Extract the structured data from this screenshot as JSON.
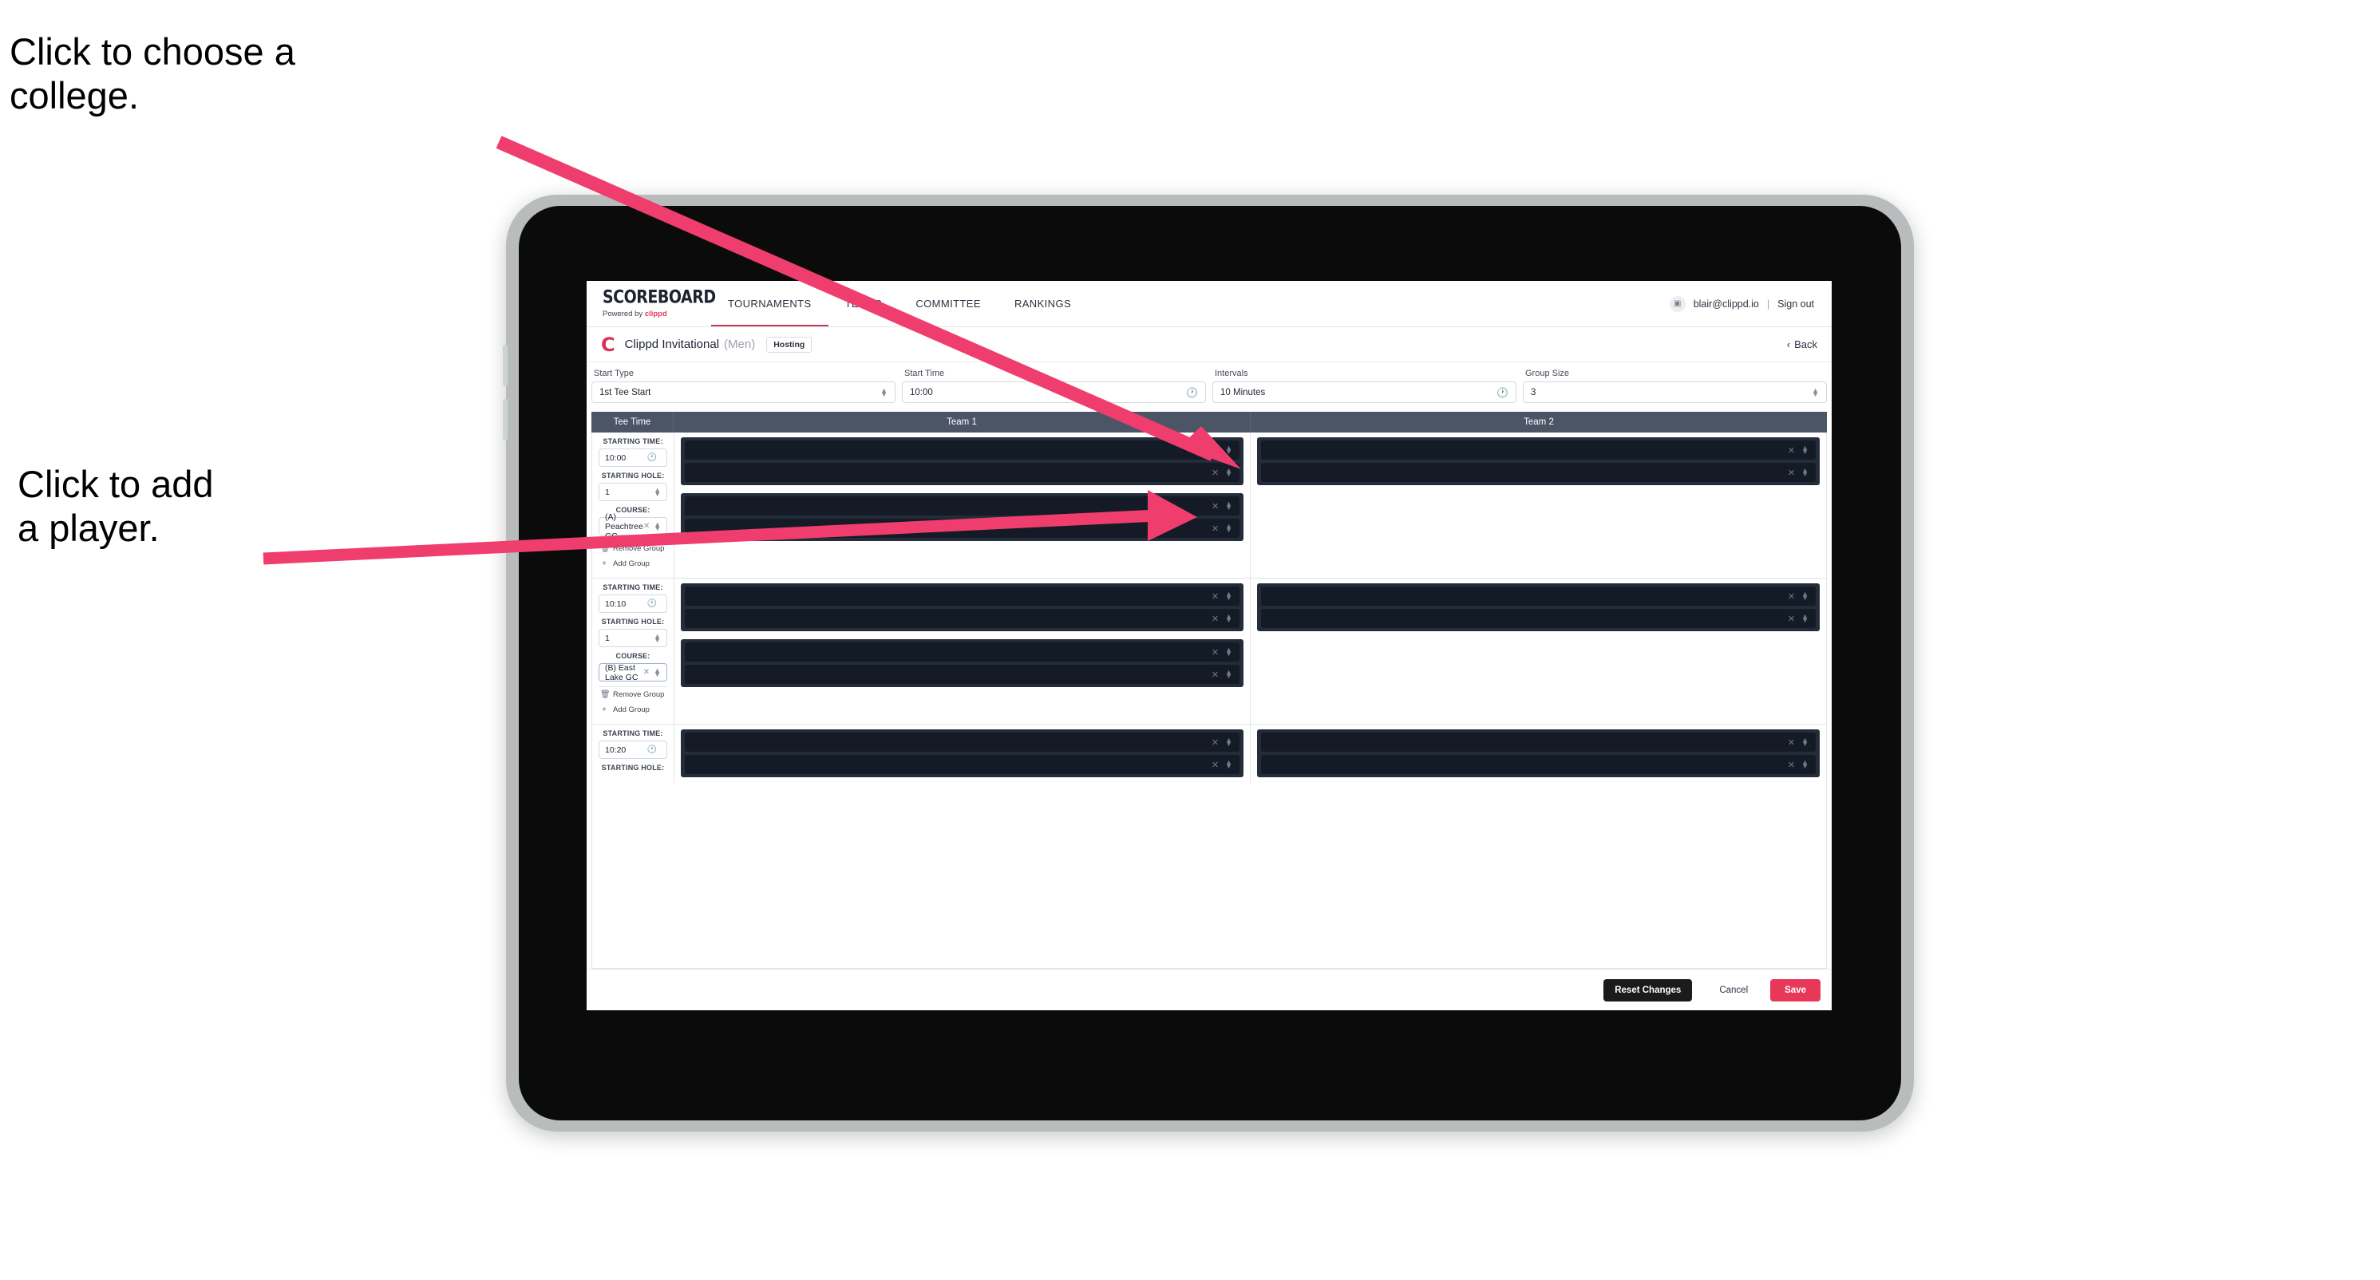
{
  "annotations": {
    "choose_college": "Click to choose a\ncollege.",
    "add_player": "Click to add\na player."
  },
  "colors": {
    "accent_pink": "#e8385a",
    "arrow_pink": "#ef3e6d",
    "header_slate": "#4c5566",
    "slot_dark": "#141a26",
    "card_dark": "#242c3a"
  },
  "topbar": {
    "logo_word": "SCOREBOARD",
    "logo_sub_prefix": "Powered by ",
    "logo_sub_brand": "clippd",
    "tabs": [
      {
        "label": "TOURNAMENTS",
        "active": true
      },
      {
        "label": "TEAMS",
        "active": false
      },
      {
        "label": "COMMITTEE",
        "active": false
      },
      {
        "label": "RANKINGS",
        "active": false
      }
    ],
    "avatar_icon": "user-avatar-icon",
    "user_email": "blair@clippd.io",
    "separator": "|",
    "sign_out": "Sign out"
  },
  "tournament": {
    "logo_letter": "C",
    "name": "Clippd Invitational",
    "gender": "(Men)",
    "badge": "Hosting",
    "back_chevron": "‹",
    "back_label": "Back"
  },
  "settings": [
    {
      "label": "Start Type",
      "value": "1st Tee Start",
      "icon": "stepper-icon"
    },
    {
      "label": "Start Time",
      "value": "10:00",
      "icon": "clock-icon"
    },
    {
      "label": "Intervals",
      "value": "10 Minutes",
      "icon": "clock-icon"
    },
    {
      "label": "Group Size",
      "value": "3",
      "icon": "stepper-icon"
    }
  ],
  "table": {
    "headers": {
      "tee_time": "Tee Time",
      "team1": "Team 1",
      "team2": "Team 2"
    },
    "field_labels": {
      "starting_time": "STARTING TIME:",
      "starting_hole": "STARTING HOLE:",
      "course": "COURSE:"
    },
    "group_actions": {
      "remove": "Remove Group",
      "remove_icon": "trash-icon",
      "add": "Add Group",
      "add_icon": "plus-icon"
    },
    "slot_icons": {
      "clear": "close-icon",
      "stepper": "stepper-icon"
    },
    "groups": [
      {
        "starting_time": "10:00",
        "starting_hole": "1",
        "course": "(A) Peachtree GC",
        "course_focused": false,
        "team1_cards": [
          {
            "slots": 2
          },
          {
            "slots": 2
          }
        ],
        "team2_cards": [
          {
            "slots": 2
          }
        ]
      },
      {
        "starting_time": "10:10",
        "starting_hole": "1",
        "course": "(B) East Lake GC",
        "course_focused": true,
        "team1_cards": [
          {
            "slots": 2
          },
          {
            "slots": 2
          }
        ],
        "team2_cards": [
          {
            "slots": 2
          }
        ]
      },
      {
        "starting_time": "10:20",
        "starting_hole": "",
        "course": "",
        "course_focused": false,
        "team1_cards": [
          {
            "slots": 2
          }
        ],
        "team2_cards": [
          {
            "slots": 2
          }
        ]
      }
    ]
  },
  "footer": {
    "reset": "Reset Changes",
    "cancel": "Cancel",
    "save": "Save"
  }
}
